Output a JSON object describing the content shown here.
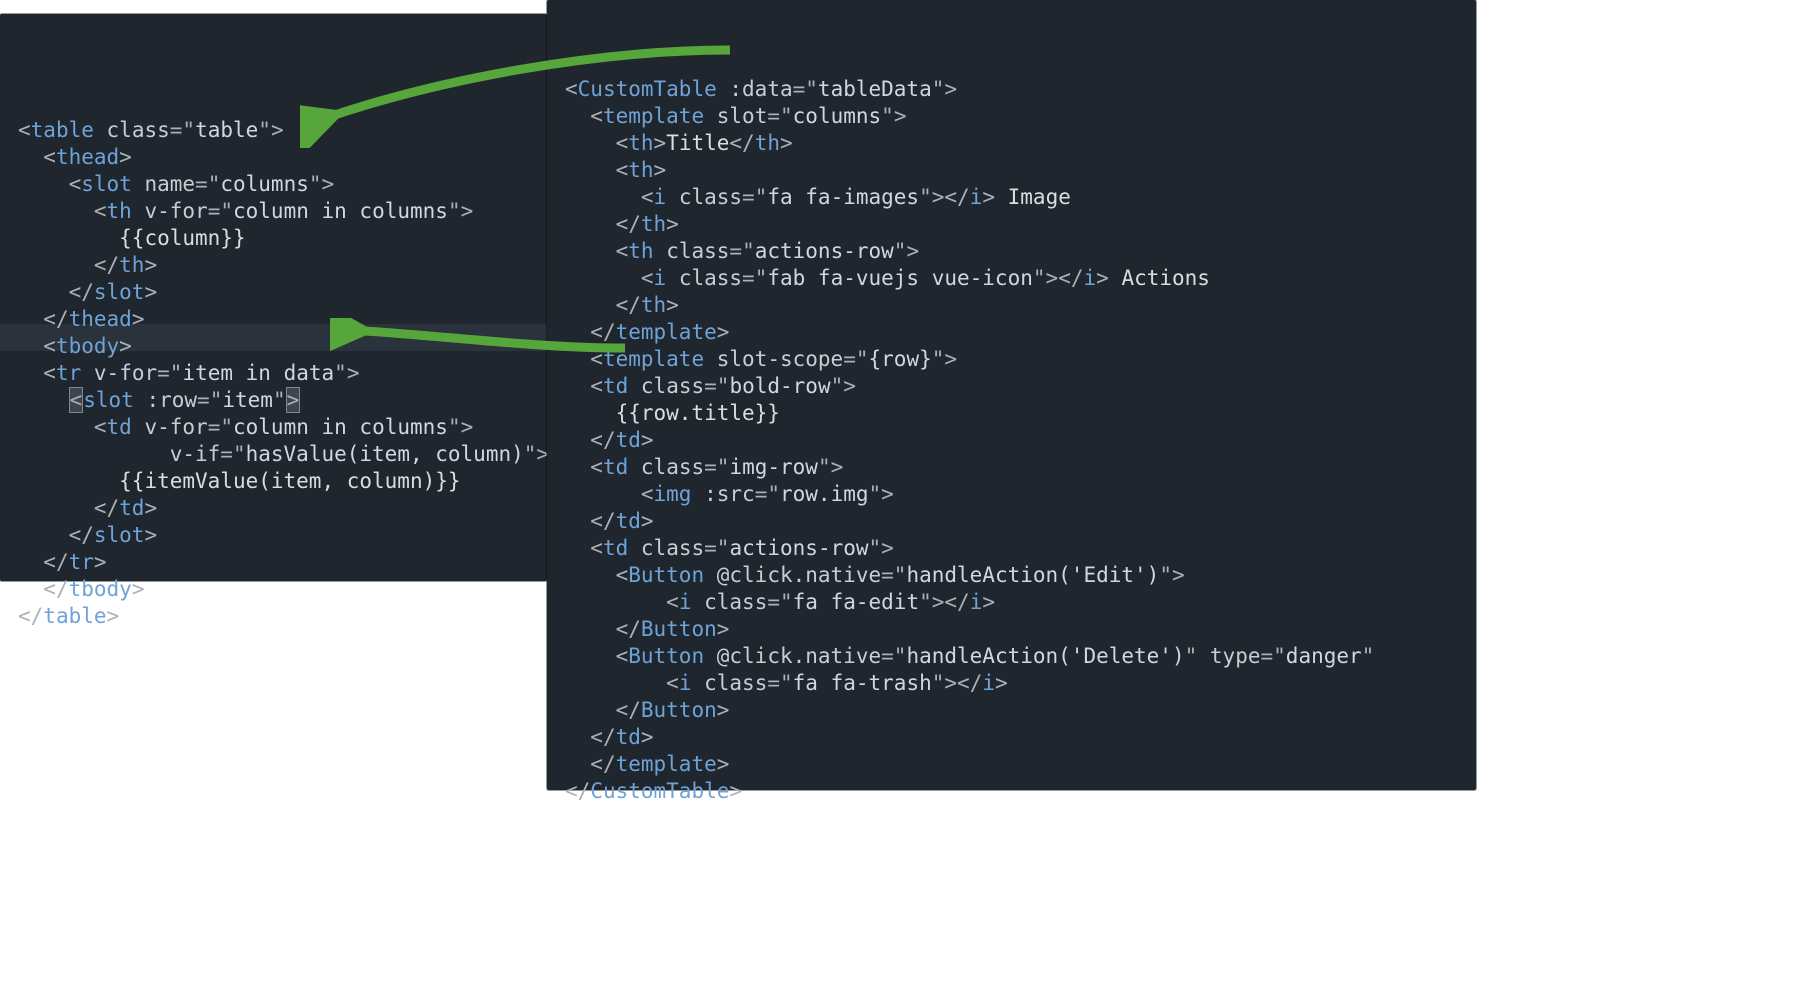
{
  "colors": {
    "bg": "#1f262e",
    "tag": "#6fa3d7",
    "text": "#d9dee3",
    "arrow": "#56a63b"
  },
  "left_pane": {
    "name": "component-definition",
    "lines": [
      {
        "indent": 0,
        "kind": "open",
        "tag": "table",
        "attrs": [
          {
            "name": "class",
            "value": "table"
          }
        ]
      },
      {
        "indent": 1,
        "kind": "open",
        "tag": "thead"
      },
      {
        "indent": 2,
        "kind": "open",
        "tag": "slot",
        "attrs": [
          {
            "name": "name",
            "value": "columns"
          }
        ]
      },
      {
        "indent": 3,
        "kind": "open",
        "tag": "th",
        "attrs": [
          {
            "name": "v-for",
            "value": "column in columns"
          }
        ]
      },
      {
        "indent": 4,
        "kind": "text",
        "text": "{{column}}"
      },
      {
        "indent": 3,
        "kind": "close",
        "tag": "th"
      },
      {
        "indent": 2,
        "kind": "close",
        "tag": "slot"
      },
      {
        "indent": 1,
        "kind": "close",
        "tag": "thead"
      },
      {
        "indent": 1,
        "kind": "open",
        "tag": "tbody"
      },
      {
        "indent": 1,
        "kind": "open",
        "tag": "tr",
        "attrs": [
          {
            "name": "v-for",
            "value": "item in data"
          }
        ]
      },
      {
        "indent": 2,
        "kind": "open",
        "tag": "slot",
        "attrs": [
          {
            "name": ":row",
            "value": "item"
          }
        ],
        "highlighted": true,
        "selected_close_bracket": true
      },
      {
        "indent": 3,
        "kind": "open",
        "tag": "td",
        "attrs": [
          {
            "name": "v-for",
            "value": "column in columns"
          }
        ]
      },
      {
        "indent": 6,
        "kind": "attr-only",
        "attrs": [
          {
            "name": "v-if",
            "value": "hasValue(item, column)"
          }
        ],
        "closes": true
      },
      {
        "indent": 4,
        "kind": "text",
        "text": "{{itemValue(item, column)}}"
      },
      {
        "indent": 3,
        "kind": "close",
        "tag": "td"
      },
      {
        "indent": 2,
        "kind": "close",
        "tag": "slot"
      },
      {
        "indent": 1,
        "kind": "close",
        "tag": "tr"
      },
      {
        "indent": 1,
        "kind": "close",
        "tag": "tbody"
      },
      {
        "indent": 0,
        "kind": "close",
        "tag": "table"
      }
    ]
  },
  "right_pane": {
    "name": "component-usage",
    "lines": [
      {
        "indent": 0,
        "kind": "open",
        "tag": "CustomTable",
        "attrs": [
          {
            "name": ":data",
            "value": "tableData"
          }
        ]
      },
      {
        "indent": 1,
        "kind": "open",
        "tag": "template",
        "attrs": [
          {
            "name": "slot",
            "value": "columns"
          }
        ]
      },
      {
        "indent": 2,
        "kind": "wrap",
        "tag": "th",
        "text": "Title"
      },
      {
        "indent": 2,
        "kind": "open",
        "tag": "th"
      },
      {
        "indent": 3,
        "kind": "self",
        "tag": "i",
        "attrs": [
          {
            "name": "class",
            "value": "fa fa-images"
          }
        ],
        "tail": " Image"
      },
      {
        "indent": 2,
        "kind": "close",
        "tag": "th"
      },
      {
        "indent": 2,
        "kind": "open",
        "tag": "th",
        "attrs": [
          {
            "name": "class",
            "value": "actions-row"
          }
        ]
      },
      {
        "indent": 3,
        "kind": "self",
        "tag": "i",
        "attrs": [
          {
            "name": "class",
            "value": "fab fa-vuejs vue-icon"
          }
        ],
        "tail": " Actions"
      },
      {
        "indent": 2,
        "kind": "close",
        "tag": "th"
      },
      {
        "indent": 1,
        "kind": "close",
        "tag": "template"
      },
      {
        "indent": 0,
        "kind": "blank"
      },
      {
        "indent": 1,
        "kind": "open",
        "tag": "template",
        "attrs": [
          {
            "name": "slot-scope",
            "value": "{row}"
          }
        ]
      },
      {
        "indent": 1,
        "kind": "open",
        "tag": "td",
        "attrs": [
          {
            "name": "class",
            "value": "bold-row"
          }
        ]
      },
      {
        "indent": 2,
        "kind": "text",
        "text": "{{row.title}}"
      },
      {
        "indent": 1,
        "kind": "close",
        "tag": "td"
      },
      {
        "indent": 1,
        "kind": "open",
        "tag": "td",
        "attrs": [
          {
            "name": "class",
            "value": "img-row"
          }
        ]
      },
      {
        "indent": 3,
        "kind": "open",
        "tag": "img",
        "attrs": [
          {
            "name": ":src",
            "value": "row.img"
          }
        ]
      },
      {
        "indent": 1,
        "kind": "close",
        "tag": "td"
      },
      {
        "indent": 1,
        "kind": "open",
        "tag": "td",
        "attrs": [
          {
            "name": "class",
            "value": "actions-row"
          }
        ]
      },
      {
        "indent": 2,
        "kind": "open",
        "tag": "Button",
        "attrs": [
          {
            "name": "@click.native",
            "value": "handleAction('Edit')"
          }
        ]
      },
      {
        "indent": 4,
        "kind": "self",
        "tag": "i",
        "attrs": [
          {
            "name": "class",
            "value": "fa fa-edit"
          }
        ]
      },
      {
        "indent": 2,
        "kind": "close",
        "tag": "Button"
      },
      {
        "indent": 2,
        "kind": "open",
        "tag": "Button",
        "attrs": [
          {
            "name": "@click.native",
            "value": "handleAction('Delete')"
          },
          {
            "name": "type",
            "value": "danger"
          }
        ],
        "overflow": true
      },
      {
        "indent": 4,
        "kind": "self",
        "tag": "i",
        "attrs": [
          {
            "name": "class",
            "value": "fa fa-trash"
          }
        ]
      },
      {
        "indent": 2,
        "kind": "close",
        "tag": "Button"
      },
      {
        "indent": 1,
        "kind": "close",
        "tag": "td"
      },
      {
        "indent": 1,
        "kind": "close",
        "tag": "template"
      },
      {
        "indent": 0,
        "kind": "close",
        "tag": "CustomTable"
      }
    ]
  },
  "arrows": [
    {
      "from": "right-template-columns",
      "to": "left-slot-columns"
    },
    {
      "from": "right-template-slot-scope",
      "to": "left-slot-row"
    }
  ]
}
